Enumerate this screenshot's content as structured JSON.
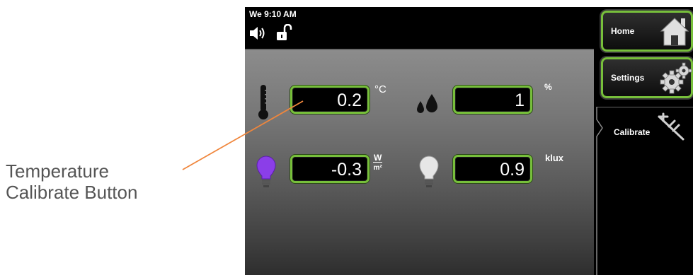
{
  "annotation": {
    "line1": "Temperature",
    "line2": "Calibrate Button"
  },
  "status": {
    "clock": "We 9:10 AM",
    "icons": [
      "speaker-icon",
      "unlocked-padlock-icon"
    ]
  },
  "readings": {
    "temperature": {
      "value": "0.2",
      "unit": "°C",
      "icon": "thermometer-icon"
    },
    "humidity": {
      "value": "1",
      "unit": "%",
      "icon": "water-drops-icon"
    },
    "uv": {
      "value": "-0.3",
      "unit_numerator": "W",
      "unit_denominator": "m²",
      "icon": "purple-bulb-icon"
    },
    "illuminance": {
      "value": "0.9",
      "unit": "klux",
      "icon": "white-bulb-icon"
    }
  },
  "nav": {
    "home_label": "Home",
    "settings_label": "Settings",
    "calibrate_label": "Calibrate"
  },
  "colors": {
    "accent_green": "#77bf3b",
    "pointer_orange": "#f0863c",
    "uv_purple": "#8b3ee8"
  }
}
